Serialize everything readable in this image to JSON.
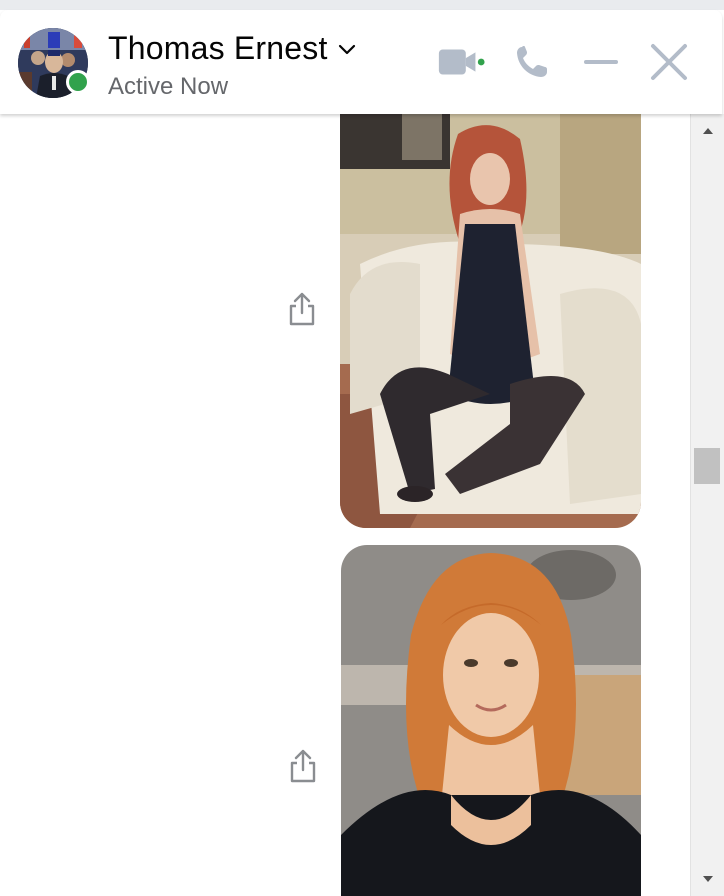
{
  "header": {
    "contact_name": "Thomas Ernest",
    "status": "Active Now",
    "avatar_icon": "user-avatar",
    "presence_color": "#31a24c",
    "accent_color": "#b3bcc9"
  },
  "actions": {
    "video_icon": "video-camera-icon",
    "call_icon": "phone-icon",
    "minimize_icon": "minimize-icon",
    "close_icon": "close-icon"
  },
  "messages": [
    {
      "type": "photo",
      "share_icon": "share-icon"
    },
    {
      "type": "photo",
      "share_icon": "share-icon"
    }
  ],
  "scrollbar": {
    "up_icon": "arrow-up-icon",
    "down_icon": "arrow-down-icon"
  }
}
